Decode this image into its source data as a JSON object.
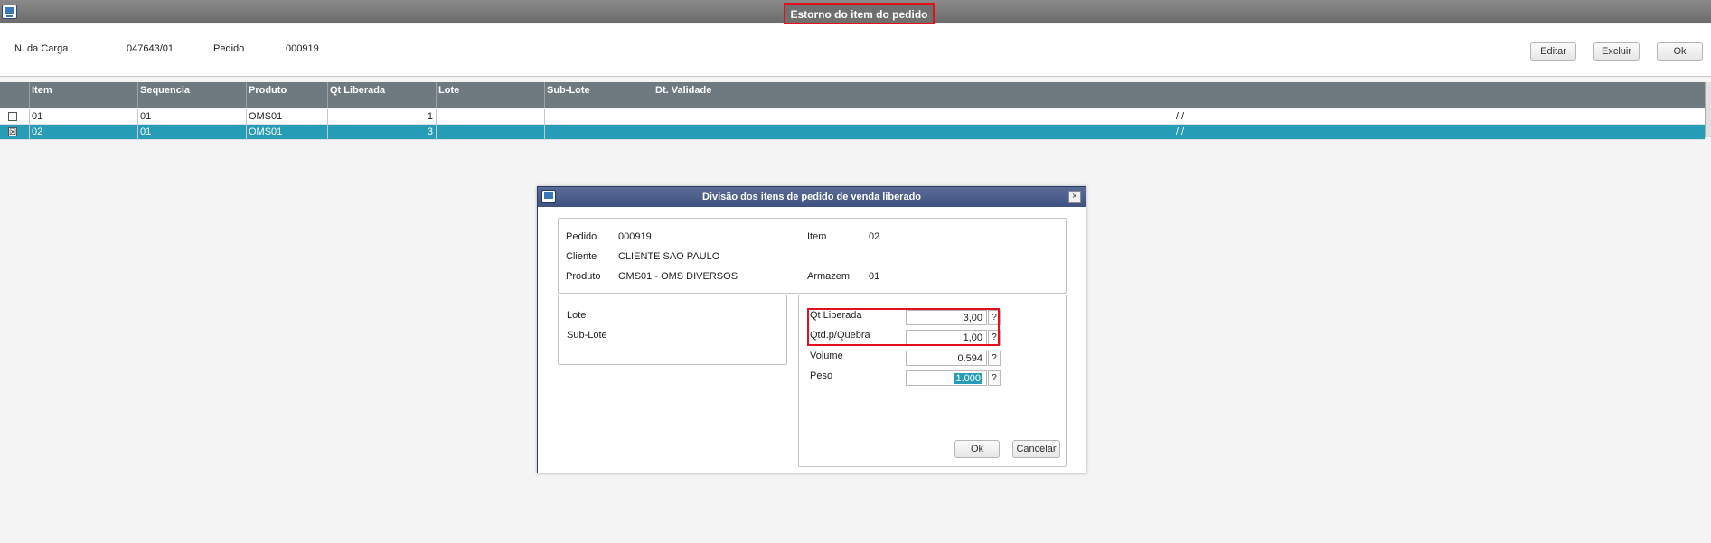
{
  "window": {
    "title": "Estorno do item do pedido",
    "icon": "window-icon"
  },
  "header": {
    "carga_label": "N. da Carga",
    "carga_value": "047643/01",
    "pedido_label": "Pedido",
    "pedido_value": "000919"
  },
  "toolbar": {
    "editar": "Editar",
    "excluir": "Excluir",
    "ok": "Ok"
  },
  "grid": {
    "columns": [
      "Item",
      "Sequencia",
      "Produto",
      "Qt Liberada",
      "Lote",
      "Sub-Lote",
      "Dt. Validade"
    ],
    "rows": [
      {
        "checked": "",
        "item": "01",
        "sequencia": "01",
        "produto": "OMS01",
        "qt_liberada": "1",
        "lote": "",
        "sub_lote": "",
        "dt_validade": "/ /"
      },
      {
        "checked": "☒",
        "item": "02",
        "sequencia": "01",
        "produto": "OMS01",
        "qt_liberada": "3",
        "lote": "",
        "sub_lote": "",
        "dt_validade": "/ /"
      }
    ]
  },
  "modal": {
    "title": "Divisão dos itens de pedido de venda liberado",
    "close": "×",
    "info": {
      "pedido_label": "Pedido",
      "pedido_value": "000919",
      "item_label": "Item",
      "item_value": "02",
      "cliente_label": "Cliente",
      "cliente_value": "CLIENTE SAO PAULO",
      "produto_label": "Produto",
      "produto_value": "OMS01 - OMS DIVERSOS",
      "armazem_label": "Armazem",
      "armazem_value": "01"
    },
    "left": {
      "lote_label": "Lote",
      "sublote_label": "Sub-Lote"
    },
    "right": {
      "qt_liberada_label": "Qt Liberada",
      "qt_liberada_value": "3,00",
      "qtd_quebra_label": "Qtd.p/Quebra",
      "qtd_quebra_value": "1,00",
      "volume_label": "Volume",
      "volume_value": "0.594",
      "peso_label": "Peso",
      "peso_value": "1.000",
      "help": "?"
    },
    "buttons": {
      "ok": "Ok",
      "cancelar": "Cancelar"
    }
  },
  "colors": {
    "accent": "#279cb7",
    "highlight": "#e3101c",
    "grid_header": "#6e7a80",
    "modal_title": "#3f5280"
  }
}
